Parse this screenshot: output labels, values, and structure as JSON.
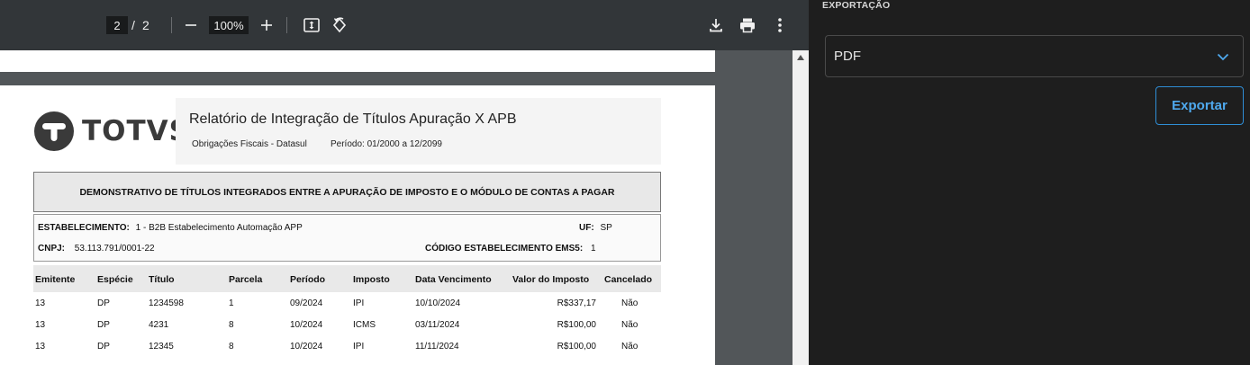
{
  "viewer": {
    "current_page": "2",
    "page_separator": "/",
    "total_pages": "2",
    "zoom": "100%"
  },
  "report": {
    "logo_text": "TOTVS",
    "title": "Relatório de Integração de Títulos Apuração X APB",
    "subtitle": "Obrigações Fiscais - Datasul",
    "period": "Período:  01/2000  a  12/2099",
    "section_title": "DEMONSTRATIVO DE TÍTULOS INTEGRADOS ENTRE A APURAÇÃO DE IMPOSTO E O MÓDULO DE CONTAS A PAGAR",
    "estabelecimento_label": "ESTABELECIMENTO:",
    "estabelecimento_value": "1 - B2B  Estabelecimento Automação APP",
    "uf_label": "UF:",
    "uf_value": "SP",
    "cnpj_label": "CNPJ:",
    "cnpj_value": "53.113.791/0001-22",
    "ems5_label": "CÓDIGO ESTABELECIMENTO EMS5:",
    "ems5_value": "1",
    "columns": [
      "Emitente",
      "Espécie",
      "Título",
      "Parcela",
      "Período",
      "Imposto",
      "Data Vencimento",
      "Valor do Imposto",
      "Cancelado"
    ],
    "rows": [
      [
        "13",
        "DP",
        "1234598",
        "1",
        "09/2024",
        "IPI",
        "10/10/2024",
        "R$337,17",
        "Não"
      ],
      [
        "13",
        "DP",
        "4231",
        "8",
        "10/2024",
        "ICMS",
        "03/11/2024",
        "R$100,00",
        "Não"
      ],
      [
        "13",
        "DP",
        "12345",
        "8",
        "10/2024",
        "IPI",
        "11/11/2024",
        "R$100,00",
        "Não"
      ]
    ]
  },
  "panel": {
    "label": "EXPORTAÇÃO",
    "format_selected": "PDF",
    "export_button": "Exportar"
  },
  "colors": {
    "toolbar_bg": "#323639",
    "panel_bg": "#1e1e1e",
    "accent": "#4fa9ee"
  }
}
